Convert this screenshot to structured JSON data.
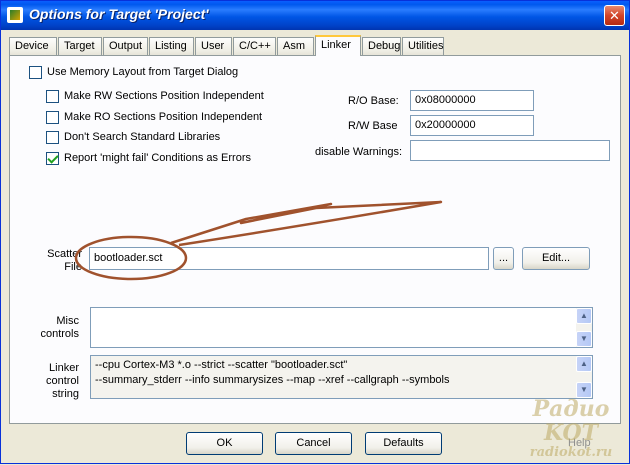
{
  "window": {
    "title": "Options for Target 'Project'",
    "close_glyph": "✕"
  },
  "tabs": [
    {
      "label": "Device"
    },
    {
      "label": "Target"
    },
    {
      "label": "Output"
    },
    {
      "label": "Listing"
    },
    {
      "label": "User"
    },
    {
      "label": "C/C++"
    },
    {
      "label": "Asm"
    },
    {
      "label": "Linker",
      "active": true
    },
    {
      "label": "Debug"
    },
    {
      "label": "Utilities"
    }
  ],
  "linker": {
    "use_memory_layout": {
      "label": "Use Memory Layout from Target Dialog",
      "checked": false
    },
    "options": [
      {
        "label": "Make RW Sections Position Independent",
        "checked": false
      },
      {
        "label": "Make RO Sections Position Independent",
        "checked": false
      },
      {
        "label": "Don't Search Standard Libraries",
        "checked": false
      },
      {
        "label": "Report 'might fail' Conditions as Errors",
        "checked": true
      }
    ],
    "ro_base": {
      "label": "R/O Base:",
      "value": "0x08000000"
    },
    "rw_base": {
      "label": "R/W Base",
      "value": "0x20000000"
    },
    "disable_warnings": {
      "label": "disable Warnings:",
      "value": ""
    },
    "scatter_file": {
      "label": "Scatter\nFile",
      "value": "bootloader.sct",
      "browse_label": "...",
      "edit_label": "Edit..."
    },
    "misc_controls": {
      "label": "Misc\ncontrols",
      "value": ""
    },
    "linker_control_string": {
      "label": "Linker\ncontrol\nstring",
      "lines": [
        "--cpu Cortex-M3 *.o --strict --scatter \"bootloader.sct\"",
        "--summary_stderr --info summarysizes --map --xref --callgraph --symbols"
      ]
    }
  },
  "buttons": {
    "ok": "OK",
    "cancel": "Cancel",
    "defaults": "Defaults",
    "help": "Help"
  },
  "annotation": {
    "color": "#a0522d"
  },
  "watermark": {
    "line1": "Радио KOT",
    "line2": "radiokot.ru"
  }
}
